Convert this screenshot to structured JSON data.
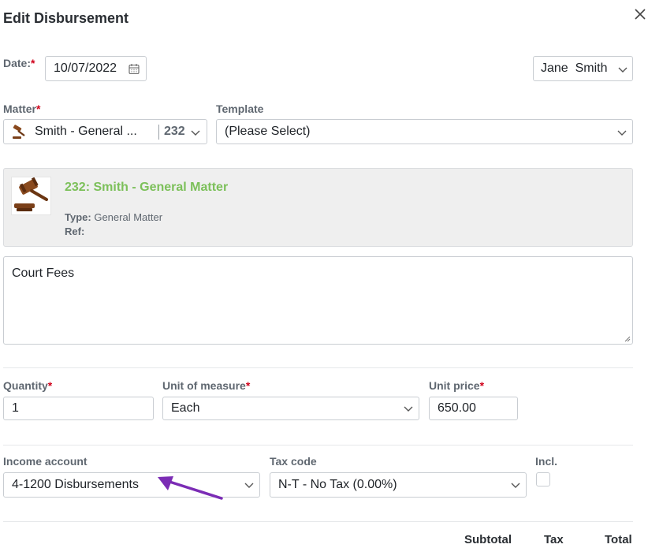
{
  "dialog": {
    "title": "Edit Disbursement"
  },
  "date": {
    "label": "Date:",
    "required_mark": "*",
    "value": "10/07/2022"
  },
  "user": {
    "value": "Jane  Smith"
  },
  "matter": {
    "label": "Matter",
    "required_mark": "*",
    "value": "Smith - General ...",
    "number": "232",
    "card_title": "232: Smith - General Matter",
    "type_label": "Type:",
    "type_value": "General Matter",
    "ref_label": "Ref:",
    "ref_value": ""
  },
  "template": {
    "label": "Template",
    "value": "(Please Select)"
  },
  "description": {
    "value": "Court Fees"
  },
  "quantity": {
    "label": "Quantity",
    "required_mark": "*",
    "value": "1"
  },
  "unit_of_measure": {
    "label": "Unit of measure",
    "required_mark": "*",
    "value": "Each"
  },
  "unit_price": {
    "label": "Unit price",
    "required_mark": "*",
    "value": "650.00"
  },
  "income_account": {
    "label": "Income account",
    "value": "4-1200 Disbursements"
  },
  "tax_code": {
    "label": "Tax code",
    "value": "N-T - No Tax (0.00%)"
  },
  "incl": {
    "label": "Incl.",
    "checked": false
  },
  "totals": {
    "subtotal_label": "Subtotal",
    "tax_label": "Tax",
    "total_label": "Total"
  },
  "icons": {
    "close": "close-icon",
    "calendar": "calendar-icon",
    "chevron": "chevron-down-icon",
    "gavel": "gavel-icon",
    "annotation": "arrow-annotation-icon"
  },
  "colors": {
    "required": "#d0021b",
    "matter_title": "#7cc05a",
    "annotation_arrow": "#7b2cb5"
  }
}
